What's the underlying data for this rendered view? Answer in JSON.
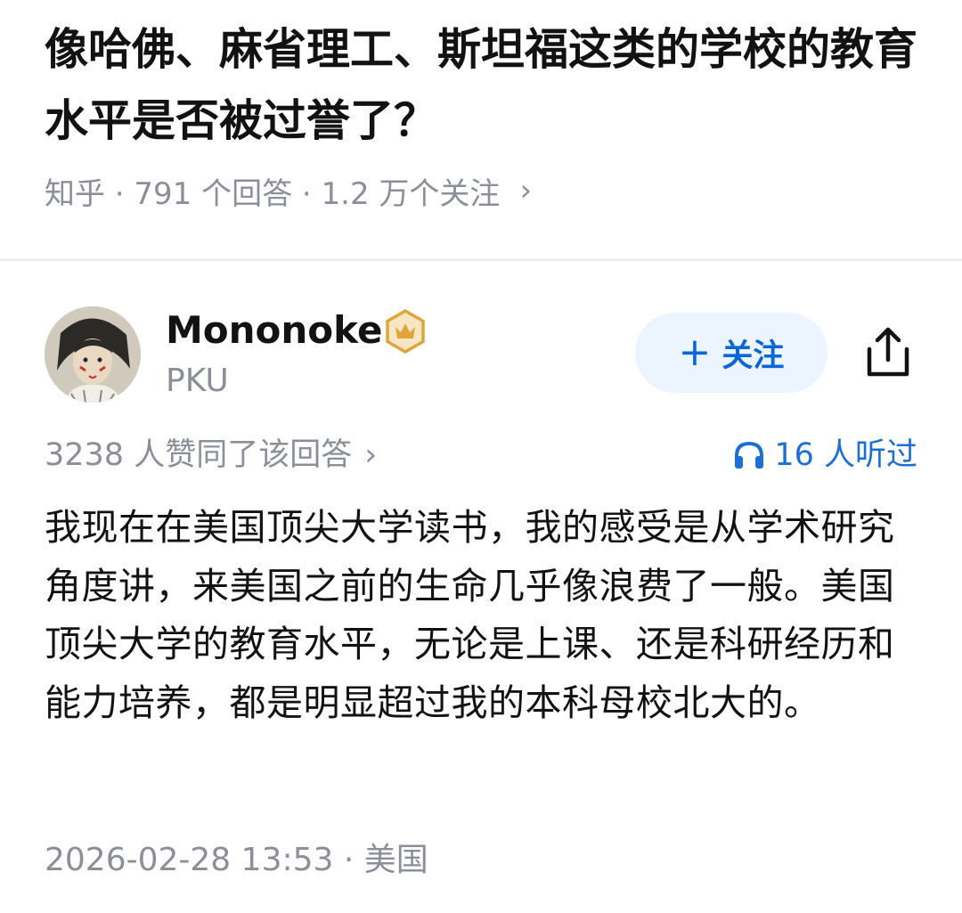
{
  "question": {
    "title": "像哈佛、麻省理工、斯坦福这类的学校的教育水平是否被过誉了？",
    "meta": "知乎 · 791 个回答 · 1.2 万个关注",
    "chevron": "›"
  },
  "author": {
    "name": "Mononoke",
    "bio": "PKU",
    "badge_icon": "crown-badge-icon"
  },
  "actions": {
    "follow_plus": "+",
    "follow_label": "关注",
    "share_icon": "share-icon"
  },
  "stats": {
    "likes": "3238 人赞同了该回答",
    "likes_chevron": "›",
    "listen": "16 人听过",
    "listen_icon": "headphones-icon"
  },
  "answer": {
    "text": "我现在在美国顶尖大学读书，我的感受是从学术研究角度讲，来美国之前的生命几乎像浪费了一般。美国顶尖大学的教育水平，无论是上课、还是科研经历和能力培养，都是明显超过我的本科母校北大的。"
  },
  "footer": {
    "timestamp": "2026-02-28 13:53 · 美国"
  },
  "colors": {
    "accent": "#0a66d9",
    "follow_bg": "#ebf4ff",
    "muted": "#8a8f99",
    "badge": "#e0a53a"
  }
}
